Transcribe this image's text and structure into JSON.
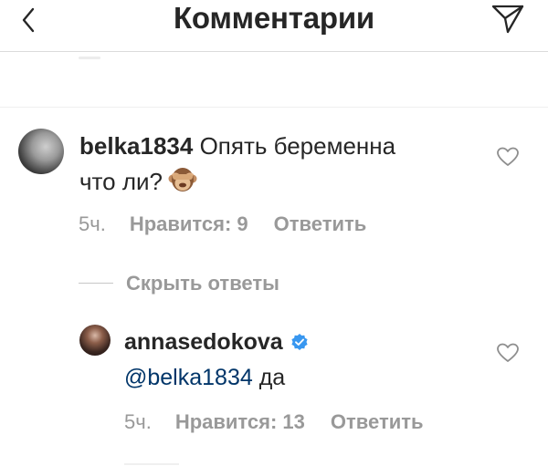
{
  "header": {
    "title": "Комментарии",
    "back_icon": "chevron-left-icon",
    "send_icon": "paper-plane-icon"
  },
  "comments": [
    {
      "username": "belka1834",
      "text_line1": "Опять беременна",
      "text_line2": "что ли?",
      "emoji": "see-no-evil-monkey-emoji",
      "time": "5ч.",
      "likes": "Нравится: 9",
      "reply": "Ответить"
    }
  ],
  "thread": {
    "hide_replies": "Скрыть ответы"
  },
  "replies": [
    {
      "username": "annasedokova",
      "verified": true,
      "mention": "@belka1834",
      "text": "да",
      "time": "5ч.",
      "likes": "Нравится: 13",
      "reply": "Ответить"
    }
  ],
  "colors": {
    "text": "#262626",
    "meta": "#999999",
    "mention": "#003569",
    "verified_badge": "#3897f0",
    "divider": "#dbdbdb"
  }
}
